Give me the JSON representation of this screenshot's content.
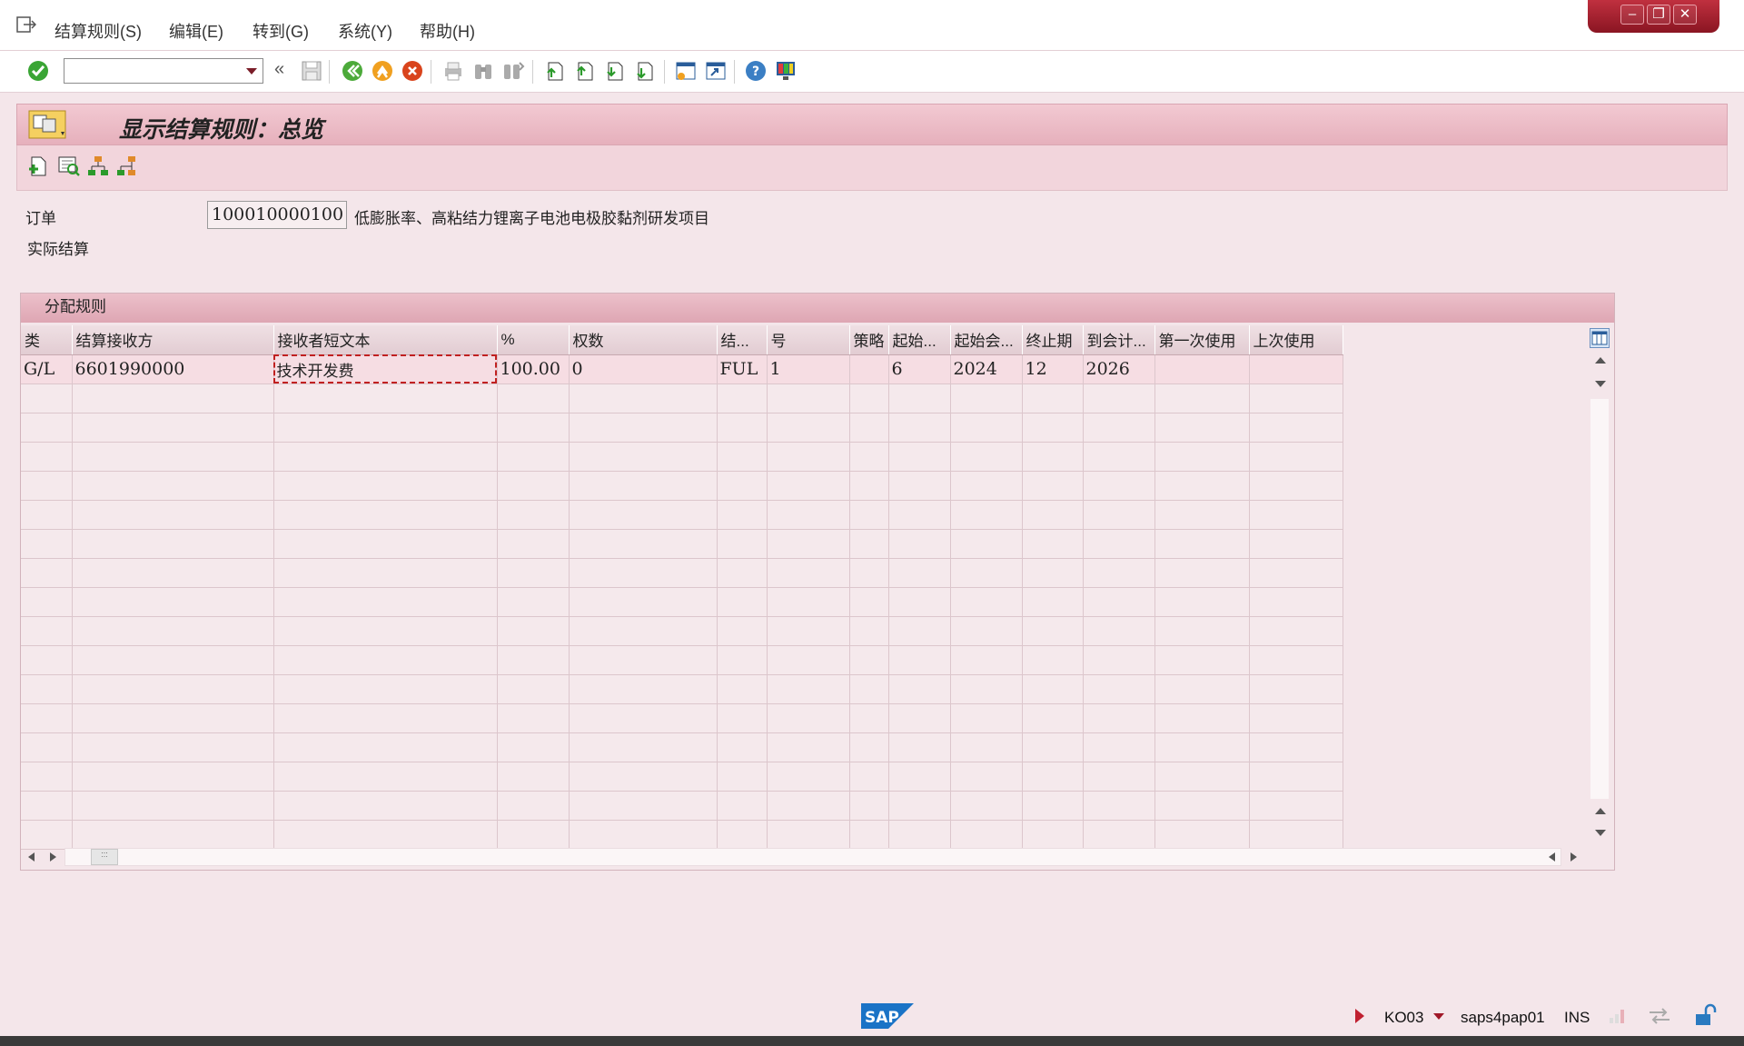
{
  "menu": {
    "items": [
      "结算规则(S)",
      "编辑(E)",
      "转到(G)",
      "系统(Y)",
      "帮助(H)"
    ]
  },
  "window_controls": {
    "minimize": "–",
    "restore": "❐",
    "close": "✕"
  },
  "toolbar": {
    "command_field_value": "",
    "collapse_label": "«"
  },
  "title": {
    "text": "显示结算规则：总览"
  },
  "header": {
    "order_label": "订单",
    "order_value": "100010000100",
    "order_description": "低膨胀率、高粘结力锂离子电池电极胶黏剂研发项目",
    "settlement_type_label": "实际结算"
  },
  "group": {
    "title": "分配规则",
    "columns": [
      "类",
      "结算接收方",
      "接收者短文本",
      "%",
      "权数",
      "结...",
      "号",
      "策略",
      "起始...",
      "起始会...",
      "终止期",
      "到会计...",
      "第一次使用",
      "上次使用"
    ],
    "rows": [
      [
        "G/L",
        "6601990000",
        "技术开发费",
        "100.00",
        "0",
        "FUL",
        "1",
        "",
        "6",
        "2024",
        "12",
        "2026",
        "",
        ""
      ]
    ],
    "empty_row_count": 16
  },
  "status": {
    "transaction": "KO03",
    "server": "saps4pap01",
    "mode": "INS"
  },
  "colors": {
    "accent": "#b72b3a",
    "title_band": "#e6b0bc",
    "background": "#f4e6ea"
  }
}
